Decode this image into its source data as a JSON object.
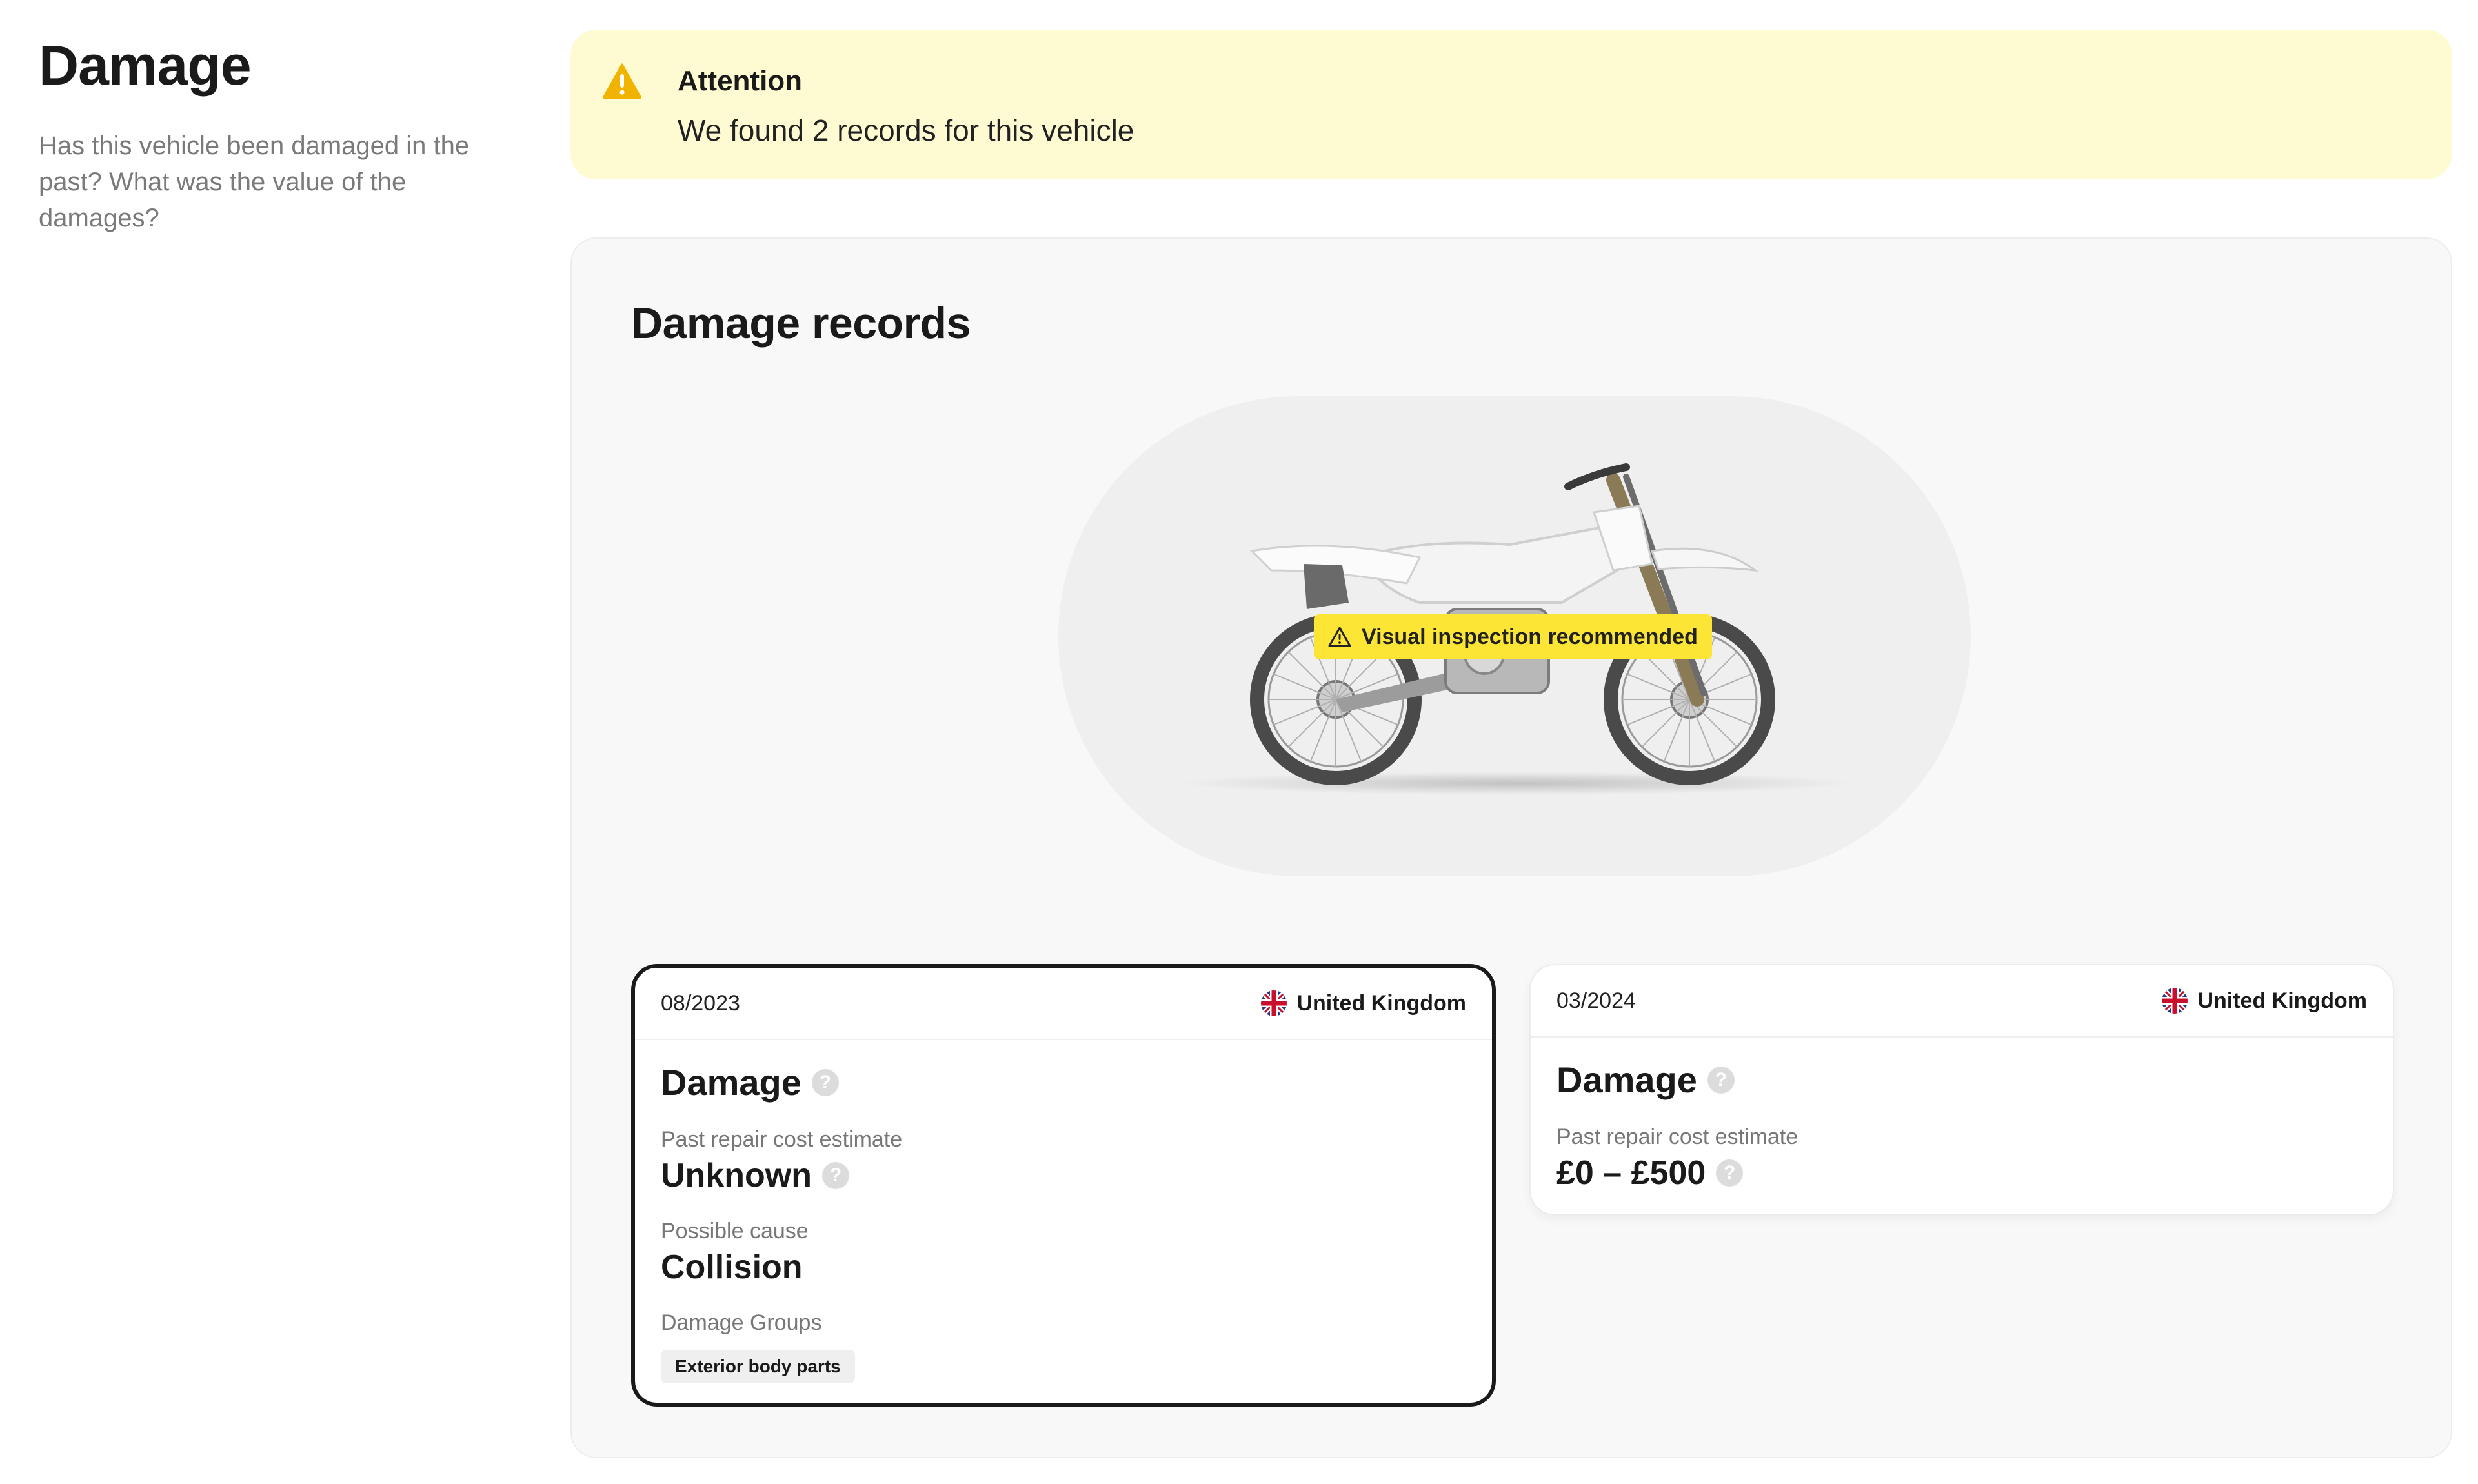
{
  "section": {
    "title": "Damage",
    "description": "Has this vehicle been damaged in the past? What was the value of the damages?"
  },
  "banner": {
    "title": "Attention",
    "message": "We found 2 records for this vehicle"
  },
  "records": {
    "heading": "Damage records",
    "badge": "Visual inspection recommended",
    "cards": [
      {
        "date": "08/2023",
        "country": "United Kingdom",
        "title": "Damage",
        "cost_label": "Past repair cost estimate",
        "cost_value": "Unknown",
        "cause_label": "Possible cause",
        "cause_value": "Collision",
        "groups_label": "Damage Groups",
        "groups": [
          "Exterior body parts"
        ]
      },
      {
        "date": "03/2024",
        "country": "United Kingdom",
        "title": "Damage",
        "cost_label": "Past repair cost estimate",
        "cost_value": "£0 – £500"
      }
    ]
  },
  "colors": {
    "banner_bg": "#fefad2",
    "warning_icon": "#f0b400",
    "badge_bg": "#fde535",
    "selected_border": "#1a1a1a"
  }
}
